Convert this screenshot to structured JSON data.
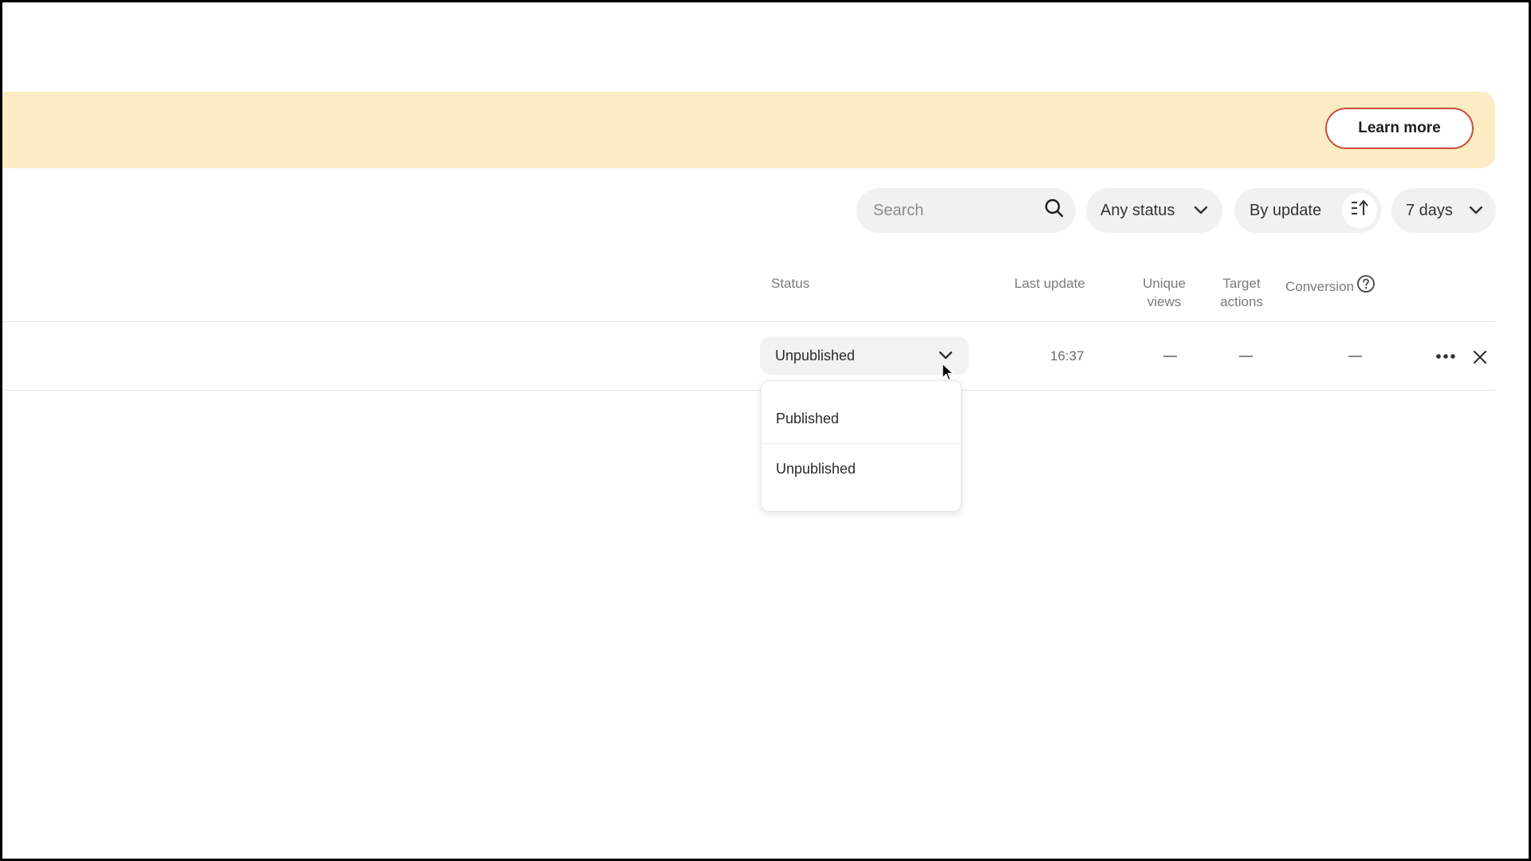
{
  "banner": {
    "learn_more_label": "Learn more",
    "background_color": "#fcecc3",
    "button_border_color": "#c94a3a"
  },
  "toolbar": {
    "search": {
      "placeholder": "Search",
      "value": "",
      "icon": "search-icon"
    },
    "status_filter": {
      "selected": "Any status",
      "icon": "chevron-down-icon"
    },
    "sort": {
      "label": "By update",
      "icon": "sort-ascending-icon"
    },
    "period": {
      "selected": "7 days",
      "icon": "chevron-down-icon"
    }
  },
  "table": {
    "columns": {
      "status": "Status",
      "last_update": "Last update",
      "unique_views_line1": "Unique",
      "unique_views_line2": "views",
      "target_actions_line1": "Target",
      "target_actions_line2": "actions",
      "conversion": "Conversion",
      "conversion_help_icon": "help-circle-icon"
    },
    "rows": [
      {
        "status": "Unpublished",
        "last_update": "16:37",
        "unique_views": "—",
        "target_actions": "—",
        "conversion": "—",
        "more_icon": "more-horizontal-icon",
        "close_icon": "close-icon"
      }
    ]
  },
  "status_dropdown": {
    "options": [
      "Published",
      "Unpublished"
    ]
  }
}
